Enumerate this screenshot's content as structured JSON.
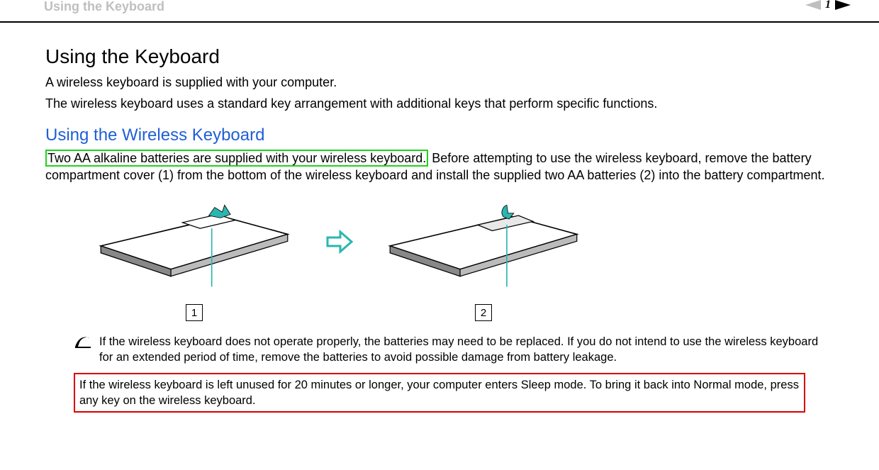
{
  "header": {
    "running_title": "Using the Keyboard",
    "page_number": "1"
  },
  "section": {
    "title": "Using the Keyboard",
    "intro1": "A wireless keyboard is supplied with your computer.",
    "intro2": "The wireless keyboard uses a standard key arrangement with additional keys that perform specific functions.",
    "sub_title": "Using the Wireless Keyboard",
    "body_hl": "Two AA alkaline batteries are supplied with your wireless keyboard.",
    "body_rest": " Before attempting to use the wireless keyboard, remove the battery compartment cover (1) from the bottom of the wireless keyboard and install the supplied two AA batteries (2) into the battery compartment."
  },
  "figure": {
    "callout1": "1",
    "callout2": "2"
  },
  "note": {
    "text": "If the wireless keyboard does not operate properly, the batteries may need to be replaced. If you do not intend to use the wireless keyboard for an extended period of time, remove the batteries to avoid possible damage from battery leakage."
  },
  "warning": {
    "text": "If the wireless keyboard is left unused for 20 minutes or longer, your computer enters Sleep mode. To bring it back into Normal mode, press any key on the wireless keyboard."
  }
}
